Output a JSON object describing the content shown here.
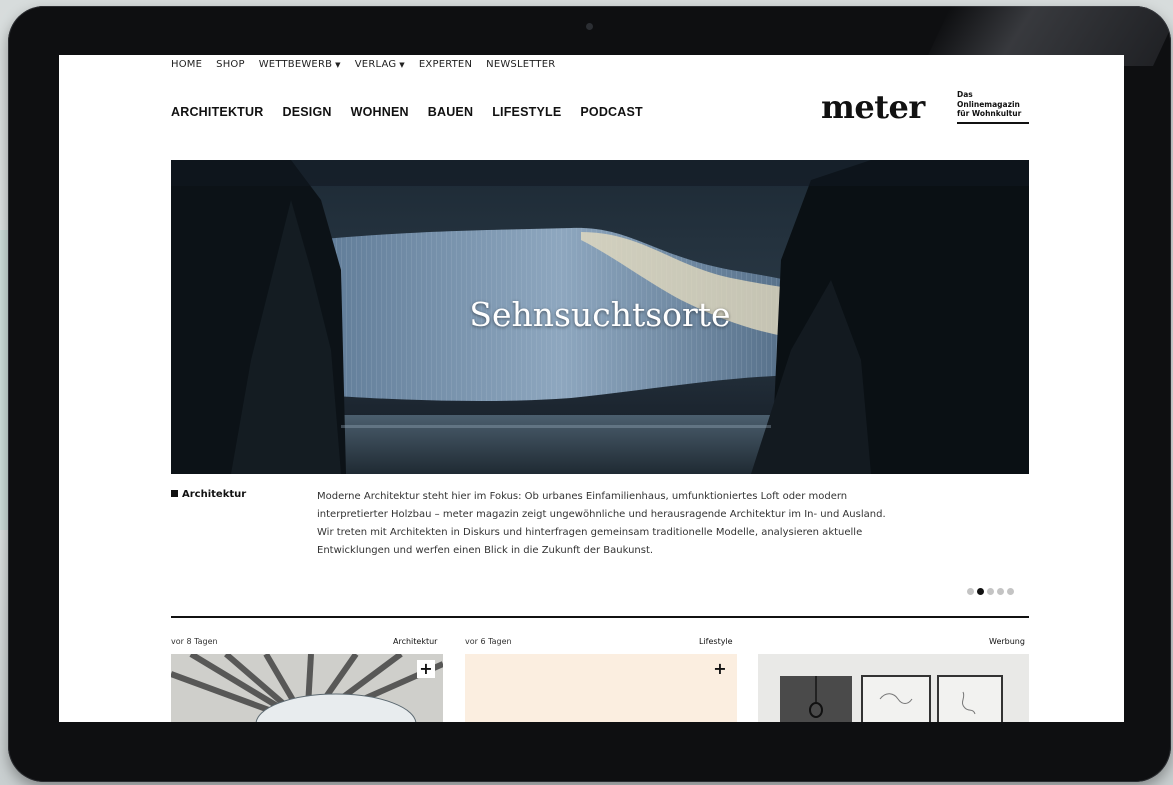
{
  "top_nav": [
    {
      "label": "HOME",
      "dropdown": false
    },
    {
      "label": "SHOP",
      "dropdown": false
    },
    {
      "label": "WETTBEWERB",
      "dropdown": true
    },
    {
      "label": "VERLAG",
      "dropdown": true
    },
    {
      "label": "EXPERTEN",
      "dropdown": false
    },
    {
      "label": "NEWSLETTER",
      "dropdown": false
    }
  ],
  "main_nav": [
    "ARCHITEKTUR",
    "DESIGN",
    "WOHNEN",
    "BAUEN",
    "LIFESTYLE",
    "PODCAST"
  ],
  "brand": {
    "logo": "meter",
    "tagline_1": "Das",
    "tagline_2": "Onlinemagazin",
    "tagline_3": "für Wohnkultur"
  },
  "hero": {
    "title": "Sehnsuchtsorte"
  },
  "feature": {
    "category": "Architektur",
    "description": "Moderne Architektur steht hier im Fokus: Ob urbanes Einfamilienhaus, umfunktioniertes Loft oder modern interpretierter Holzbau – meter magazin zeigt ungewöhnliche und herausragende Architektur im In- und Ausland. Wir treten mit Architekten in Diskurs und hinterfragen gemeinsam traditionelle Modelle, analysieren aktuelle Entwicklungen und werfen einen Blick in die Zukunft der Baukunst."
  },
  "carousel": {
    "count": 5,
    "active": 1
  },
  "cards": [
    {
      "age": "vor 8 Tagen",
      "category": "Architektur",
      "plus": "+"
    },
    {
      "age": "vor 6 Tagen",
      "category": "Lifestyle",
      "plus": "+"
    },
    {
      "age": "",
      "category": "Werbung",
      "plus": ""
    }
  ],
  "colors": {
    "text": "#111111",
    "muted": "#333333",
    "dot_inactive": "#c4c4c4",
    "card_cream": "#fbeee0",
    "device": "#0e0f11"
  }
}
